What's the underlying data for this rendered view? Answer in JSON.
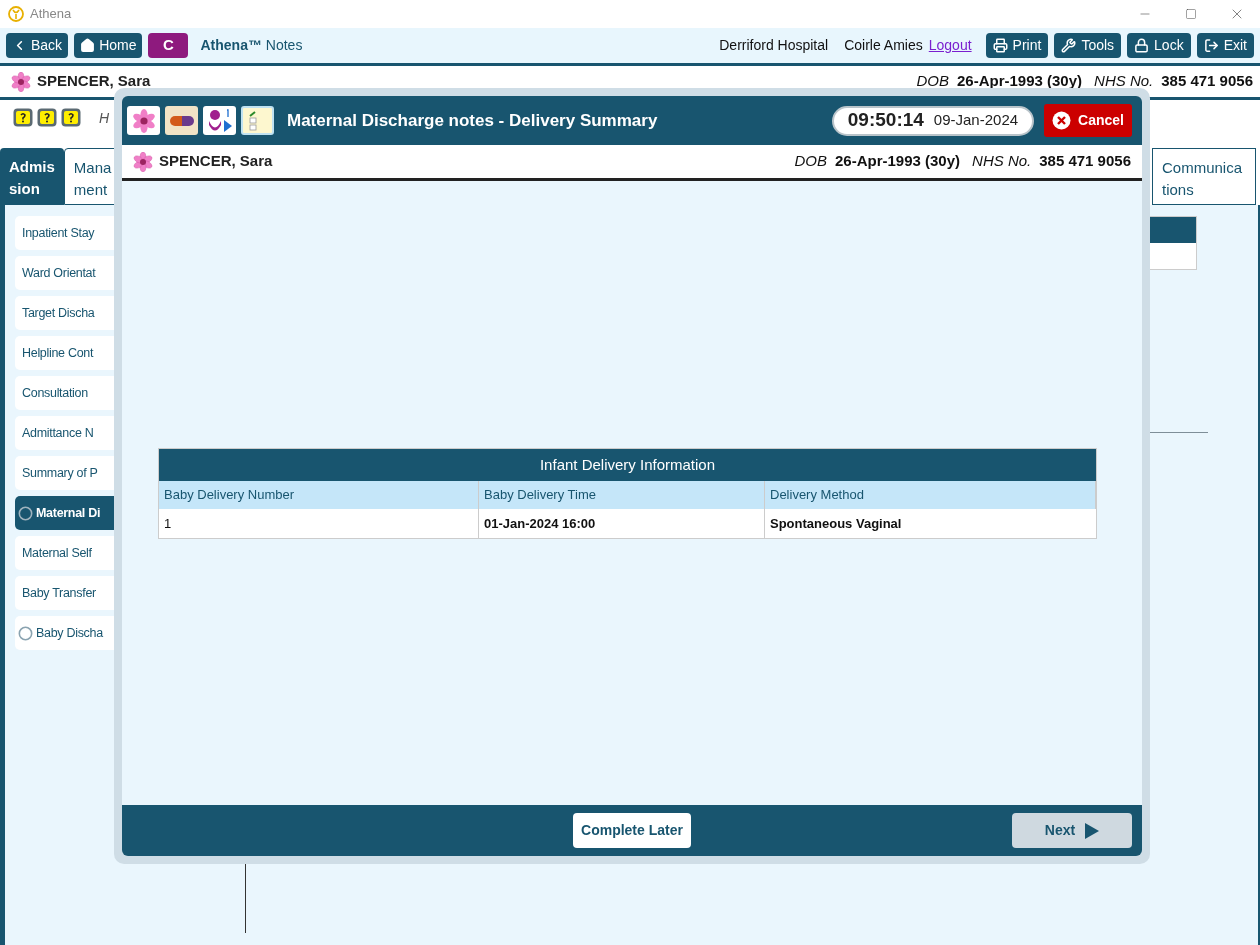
{
  "window": {
    "title": "Athena"
  },
  "toolbar": {
    "nav_buttons": [
      {
        "label": "Back"
      },
      {
        "label": "Home"
      }
    ],
    "app_badge": "C",
    "app_name": "**Athena™** Notes",
    "location": "Derriford Hospital",
    "user": "Coirle Amies",
    "logout_link": "Logout",
    "action_buttons": [
      {
        "label": "Print"
      },
      {
        "label": "Tools"
      },
      {
        "label": "Lock"
      },
      {
        "label": "Exit"
      }
    ]
  },
  "patient": {
    "name": "SPENCER, Sara",
    "dob_label": "DOB",
    "dob": "26-Apr-1993 (30y)",
    "nhs_label": "NHS No.",
    "nhs": "385 471 9056"
  },
  "page_heading": "H",
  "tabs": [
    {
      "lines": [
        "Admis",
        "sion"
      ],
      "selected": true
    },
    {
      "lines": [
        "Mana",
        "ment"
      ],
      "selected": false
    },
    {
      "lines": [
        "Communica",
        "tions"
      ],
      "selected": false
    }
  ],
  "sidebar": {
    "items": [
      {
        "label": "Inpatient Stay",
        "kind": "link",
        "selected": false
      },
      {
        "label": "Ward Orientat",
        "kind": "link",
        "selected": false
      },
      {
        "label": "Target Discha",
        "kind": "link",
        "selected": false
      },
      {
        "label": "Helpline Cont",
        "kind": "link",
        "selected": false
      },
      {
        "label": "Consultation",
        "kind": "link",
        "selected": false
      },
      {
        "label": "Admittance N",
        "kind": "link",
        "selected": false
      },
      {
        "label": "Summary of P",
        "kind": "link",
        "selected": false
      },
      {
        "label": "Maternal Di",
        "kind": "radio",
        "selected": true
      },
      {
        "label": "Maternal Self",
        "kind": "link",
        "selected": false
      },
      {
        "label": "Baby Transfer",
        "kind": "link",
        "selected": false
      },
      {
        "label": "Baby Discha",
        "kind": "radio",
        "selected": false
      }
    ]
  },
  "dialog": {
    "title": "Maternal Discharge notes - Delivery Summary",
    "time": "09:50:14",
    "date": "09-Jan-2024",
    "cancel": "Cancel",
    "patient": {
      "name": "SPENCER, Sara",
      "dob_label": "DOB",
      "dob": "26-Apr-1993 (30y)",
      "nhs_label": "NHS No.",
      "nhs": "385 471 9056"
    },
    "table": {
      "title": "Infant Delivery Information",
      "columns": [
        "Baby Delivery Number",
        "Baby Delivery Time",
        "Delivery Method"
      ],
      "rows": [
        [
          "1",
          "01-Jan-2024 16:00",
          "Spontaneous Vaginal"
        ]
      ]
    },
    "buttons": [
      {
        "label": "Complete Later",
        "disabled": false
      },
      {
        "label": "Next",
        "disabled": true
      }
    ]
  }
}
